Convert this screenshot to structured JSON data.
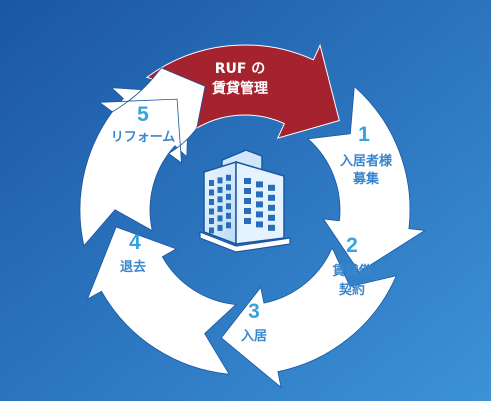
{
  "diagram": {
    "center": {
      "label": "RUFの賃貸管理",
      "line1": "RUF の",
      "line2": "賃貸管理"
    },
    "steps": [
      {
        "number": "1",
        "lines": [
          "入居者様",
          "募集"
        ]
      },
      {
        "number": "2",
        "lines": [
          "賃貸借",
          "契約"
        ]
      },
      {
        "number": "3",
        "lines": [
          "入居"
        ]
      },
      {
        "number": "4",
        "lines": [
          "退去"
        ]
      },
      {
        "number": "5",
        "lines": [
          "リフォーム"
        ]
      }
    ],
    "colors": {
      "background_start": "#1e5aa6",
      "background_end": "#3a8fd6",
      "arrow": "#ffffff",
      "highlight_arrow": "#a4232e",
      "step_text": "#3a86cc",
      "step_number": "#35a3e0",
      "building": "#d8ecfb"
    },
    "icons": {
      "center": "office-building-icon"
    }
  }
}
